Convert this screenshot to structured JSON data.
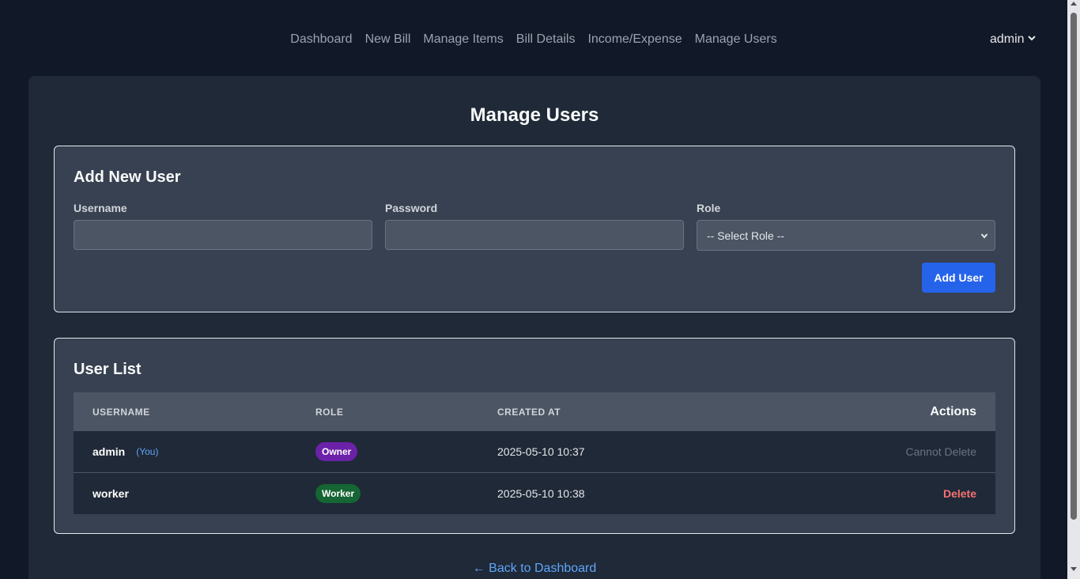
{
  "nav": {
    "links": [
      "Dashboard",
      "New Bill",
      "Manage Items",
      "Bill Details",
      "Income/Expense",
      "Manage Users"
    ],
    "user": "admin"
  },
  "page": {
    "title": "Manage Users"
  },
  "add_user": {
    "title": "Add New User",
    "username_label": "Username",
    "username_value": "",
    "password_label": "Password",
    "password_value": "",
    "role_label": "Role",
    "role_selected": "-- Select Role --",
    "submit_label": "Add User"
  },
  "user_list": {
    "title": "User List",
    "columns": [
      "USERNAME",
      "ROLE",
      "CREATED AT",
      "Actions"
    ],
    "rows": [
      {
        "username": "admin",
        "you_tag": "(You)",
        "role": "Owner",
        "created_at": "2025-05-10 10:37",
        "action": "Cannot Delete"
      },
      {
        "username": "worker",
        "you_tag": "",
        "role": "Worker",
        "created_at": "2025-05-10 10:38",
        "action": "Delete"
      }
    ]
  },
  "back_link": "← Back to Dashboard",
  "colors": {
    "background": "#111827",
    "card": "#1f2937",
    "accent": "#2563eb",
    "owner_badge": "#6b21a8",
    "worker_badge": "#166534",
    "delete": "#f87171"
  },
  "icons": {
    "user_menu": "chevron-down-icon",
    "select": "chevron-down-icon"
  }
}
